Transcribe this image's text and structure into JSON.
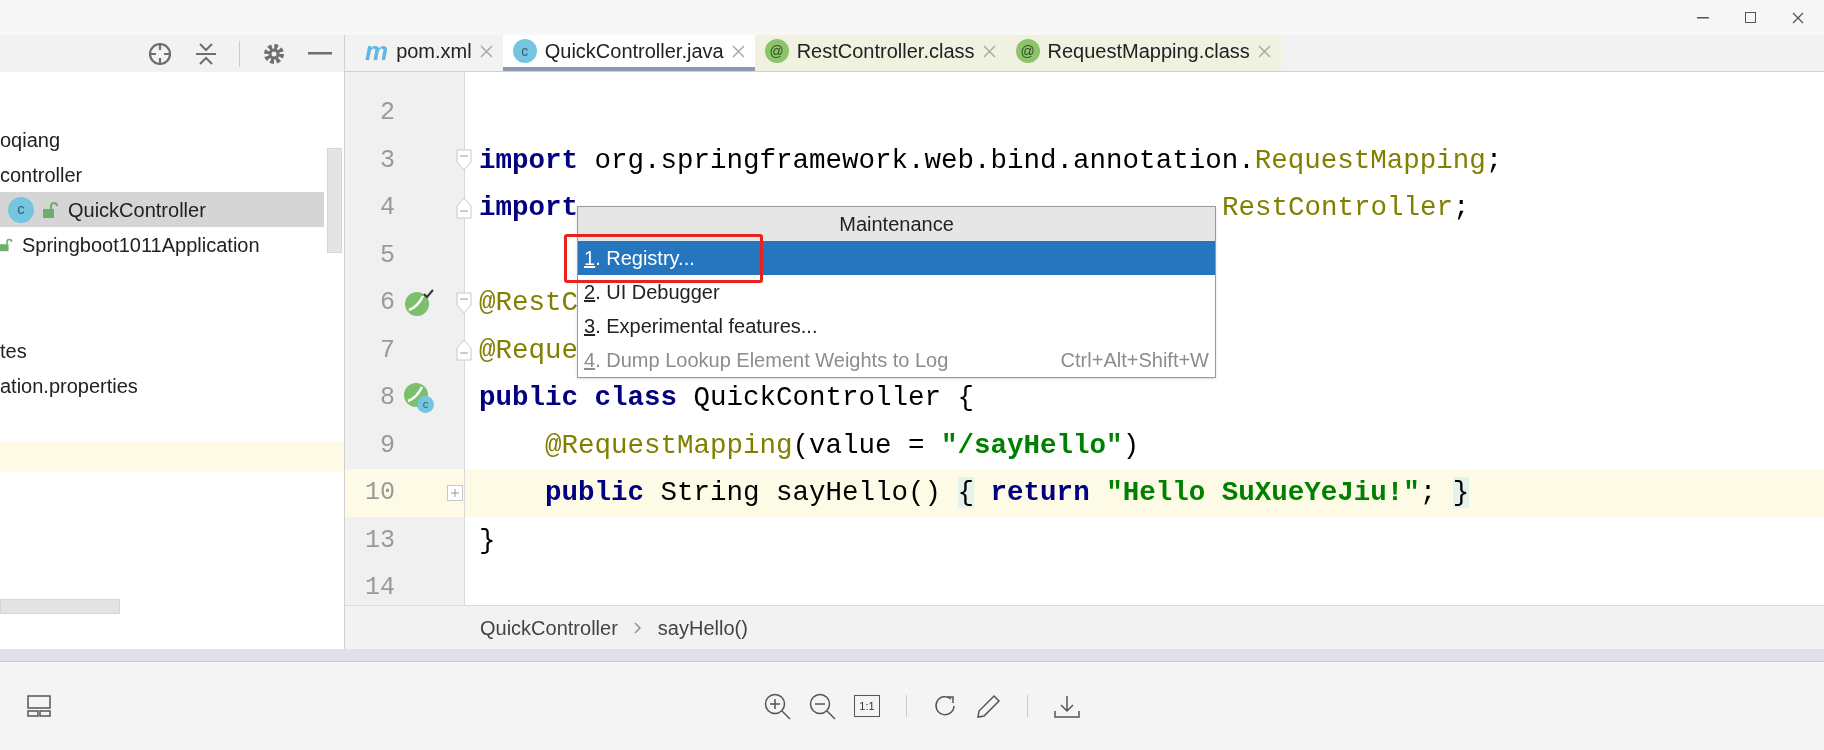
{
  "project_panel": {
    "items": [
      {
        "label": "oqiang",
        "selected": false,
        "kind": "plain"
      },
      {
        "label": "controller",
        "selected": false,
        "kind": "plain"
      },
      {
        "label": "QuickController",
        "selected": true,
        "kind": "class",
        "badge": "c"
      },
      {
        "label": "Springboot1011Application",
        "selected": false,
        "kind": "locked"
      },
      {
        "label": "tes",
        "selected": false,
        "kind": "plain"
      },
      {
        "label": "ation.properties",
        "selected": false,
        "kind": "plain"
      }
    ]
  },
  "tabs": [
    {
      "label": "pom.xml",
      "kind": "maven",
      "badge": "m",
      "selected": false
    },
    {
      "label": "QuickController.java",
      "kind": "class",
      "badge": "c",
      "selected": true
    },
    {
      "label": "RestController.class",
      "kind": "annotation",
      "badge": "@",
      "selected": false
    },
    {
      "label": "RequestMapping.class",
      "kind": "annotation",
      "badge": "@",
      "selected": false
    }
  ],
  "editor": {
    "lines": [
      {
        "number": "2",
        "current": false
      },
      {
        "number": "3",
        "current": false,
        "fold_marker": {
          "kind": "start"
        },
        "tokens": [
          {
            "text": "import",
            "kind": "keyword"
          },
          {
            "text": " org.springframework.web.bind.annotation.",
            "kind": "plain"
          },
          {
            "text": "RequestMapping",
            "kind": "annotation"
          },
          {
            "text": ";",
            "kind": "plain"
          }
        ]
      },
      {
        "number": "4",
        "current": false,
        "fold_marker": {
          "kind": "end"
        },
        "tokens": [
          {
            "text": "import",
            "kind": "keyword"
          },
          {
            "text": "RestController",
            "kind": "annotation",
            "beside_popup": true
          },
          {
            "text": ";",
            "kind": "plain",
            "beside_popup": true
          }
        ]
      },
      {
        "number": "5",
        "current": false
      },
      {
        "number": "6",
        "current": false,
        "fold_marker": {
          "kind": "start"
        },
        "gutter_icon": {
          "kind": "bean-check"
        },
        "tokens": [
          {
            "text": "@RestC",
            "kind": "annotation"
          }
        ]
      },
      {
        "number": "7",
        "current": false,
        "fold_marker": {
          "kind": "end"
        },
        "tokens": [
          {
            "text": "@Reque",
            "kind": "annotation"
          }
        ]
      },
      {
        "number": "8",
        "current": false,
        "gutter_icon": {
          "kind": "bean-class",
          "badge": "c"
        },
        "tokens": [
          {
            "text": "public class",
            "kind": "keyword"
          },
          {
            "text": " QuickController {",
            "kind": "plain"
          }
        ]
      },
      {
        "number": "9",
        "current": false,
        "tokens": [
          {
            "text": "    @RequestMapping",
            "kind": "annotation"
          },
          {
            "text": "(value = ",
            "kind": "plain"
          },
          {
            "text": "\"/sayHello\"",
            "kind": "string"
          },
          {
            "text": ")",
            "kind": "plain"
          }
        ]
      },
      {
        "number": "10",
        "current": true,
        "fold_marker": {
          "kind": "collapsed"
        },
        "tokens": [
          {
            "text": "    public",
            "kind": "keyword"
          },
          {
            "text": " String sayHello() ",
            "kind": "plain"
          },
          {
            "text": "{",
            "kind": "brace"
          },
          {
            "text": " return",
            "kind": "keyword"
          },
          {
            "text": " \"Hello SuXueYeJiu!\"",
            "kind": "string"
          },
          {
            "text": "; ",
            "kind": "plain"
          },
          {
            "text": "}",
            "kind": "brace"
          }
        ]
      },
      {
        "number": "13",
        "current": false,
        "tokens": [
          {
            "text": "}",
            "kind": "plain"
          }
        ]
      },
      {
        "number": "14",
        "current": false
      }
    ]
  },
  "popup": {
    "title": "Maintenance",
    "items": [
      {
        "number": "1",
        "label": ". Registry...",
        "selected": true,
        "disabled": false,
        "marked": true
      },
      {
        "number": "2",
        "label": ". UI Debugger",
        "selected": false,
        "disabled": false,
        "marked": false
      },
      {
        "number": "3",
        "label": ". Experimental features...",
        "selected": false,
        "disabled": false,
        "marked": false
      },
      {
        "number": "4",
        "label": ". Dump Lookup Element Weights to Log",
        "selected": false,
        "disabled": true,
        "marked": false,
        "shortcut": "Ctrl+Alt+Shift+W"
      }
    ]
  },
  "breadcrumb": [
    "QuickController",
    "sayHello()"
  ],
  "viewer_toolbar": {
    "actual_size_label": "1:1"
  }
}
